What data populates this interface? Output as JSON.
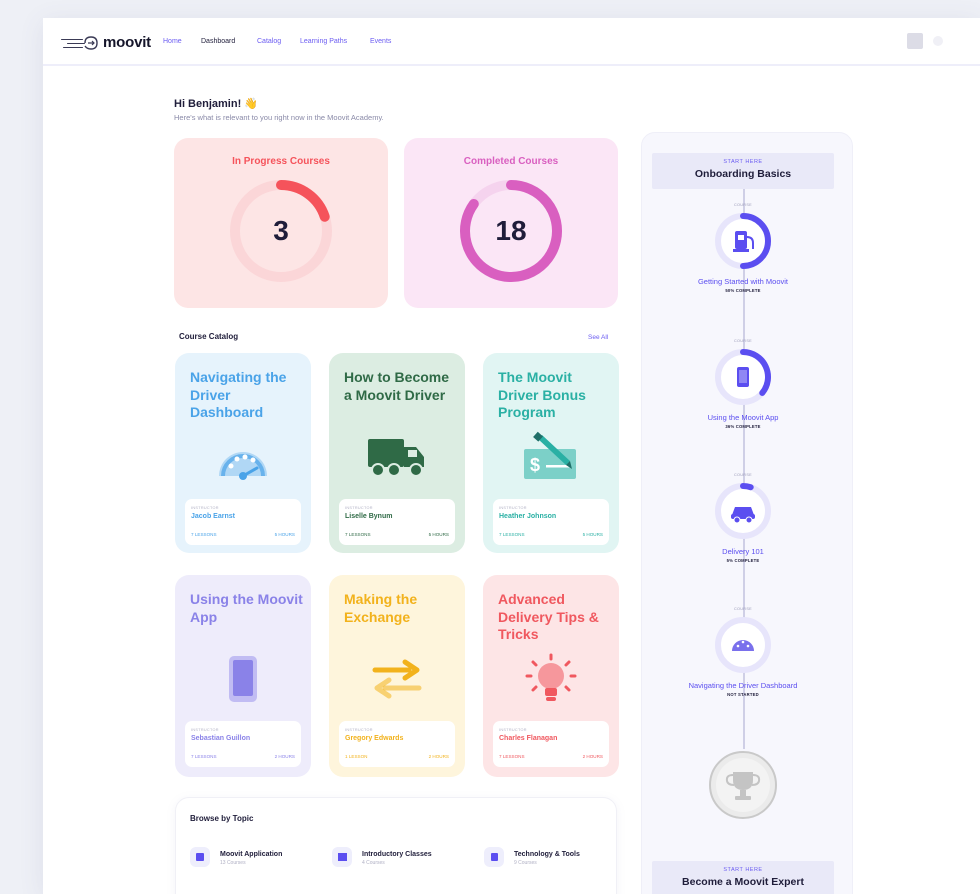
{
  "nav": {
    "brand": "moovit",
    "items": [
      {
        "label": "Home",
        "active": false
      },
      {
        "label": "Dashboard",
        "active": true
      },
      {
        "label": "Catalog",
        "active": false
      },
      {
        "label": "Learning Paths",
        "active": false
      },
      {
        "label": "Events",
        "active": false
      }
    ]
  },
  "greeting": {
    "title": "Hi Benjamin! 👋",
    "subtitle": "Here's what is relevant to you right now in the Moovit Academy."
  },
  "stats": [
    {
      "label": "In Progress Courses",
      "value": "3",
      "fraction": 0.2,
      "color": "#f5535b",
      "track": "#fbd6d8",
      "bg": "#fde5e5"
    },
    {
      "label": "Completed Courses",
      "value": "18",
      "fraction": 0.85,
      "color": "#d95fc0",
      "track": "#f5d3ee",
      "bg": "#fbe6f6"
    }
  ],
  "catalog": {
    "title": "Course Catalog",
    "see_all": "See All",
    "courses": [
      {
        "title": "Navigating the Driver Dashboard",
        "instructor_label": "INSTRUCTOR",
        "instructor": "Jacob Earnst",
        "lessons": "7 LESSONS",
        "hours": "5 HOURS",
        "icon": "speedometer-icon",
        "color": "#4aa3e8",
        "bg": "#e6f3fc"
      },
      {
        "title": "How to Become a Moovit Driver",
        "instructor_label": "INSTRUCTOR",
        "instructor": "Liselle Bynum",
        "lessons": "7 LESSONS",
        "hours": "5 HOURS",
        "icon": "delivery-truck-icon",
        "color": "#2f6a46",
        "bg": "#dcede2"
      },
      {
        "title": "The Moovit Driver Bonus Program",
        "instructor_label": "INSTRUCTOR",
        "instructor": "Heather Johnson",
        "lessons": "7 LESSONS",
        "hours": "5 HOURS",
        "icon": "check-signing-icon",
        "color": "#2ab0a4",
        "bg": "#e1f5f3"
      },
      {
        "title": "Using the Moovit App",
        "instructor_label": "INSTRUCTOR",
        "instructor": "Sebastian Guillon",
        "lessons": "7 LESSONS",
        "hours": "2 HOURS",
        "icon": "smartphone-icon",
        "color": "#8a82e8",
        "bg": "#eeecfb"
      },
      {
        "title": "Making the Exchange",
        "instructor_label": "INSTRUCTOR",
        "instructor": "Gregory Edwards",
        "lessons": "1 LESSON",
        "hours": "2 HOURS",
        "icon": "exchange-arrows-icon",
        "color": "#f2b21c",
        "bg": "#fef5dc"
      },
      {
        "title": "Advanced Delivery Tips & Tricks",
        "instructor_label": "INSTRUCTOR",
        "instructor": "Charles Flanagan",
        "lessons": "7 LESSONS",
        "hours": "2 HOURS",
        "icon": "lightbulb-icon",
        "color": "#f0585f",
        "bg": "#fde5e6"
      }
    ]
  },
  "browse": {
    "title": "Browse by Topic",
    "topics": [
      {
        "name": "Moovit Application",
        "count": "13 Courses"
      },
      {
        "name": "Introductory Classes",
        "count": "4 Courses"
      },
      {
        "name": "Technology & Tools",
        "count": "9 Courses"
      }
    ]
  },
  "path": {
    "start_label": "START HERE",
    "start_title": "Onboarding Basics",
    "nodes": [
      {
        "tag": "COURSE",
        "title": "Getting Started with Moovit",
        "status": "50% COMPLETE",
        "progress": 0.5,
        "icon": "charging-station-icon"
      },
      {
        "tag": "COURSE",
        "title": "Using the Moovit App",
        "status": "36% COMPLETE",
        "progress": 0.36,
        "icon": "smartphone-icon"
      },
      {
        "tag": "COURSE",
        "title": "Delivery 101",
        "status": "5% COMPLETE",
        "progress": 0.05,
        "icon": "car-icon"
      },
      {
        "tag": "COURSE",
        "title": "Navigating the Driver Dashboard",
        "status": "NOT STARTED",
        "progress": 0,
        "icon": "speedometer-icon"
      }
    ],
    "trophy_icon": "trophy-icon",
    "end_label": "START HERE",
    "end_title": "Become a Moovit Expert"
  },
  "colors": {
    "accent": "#5b4ef0"
  }
}
